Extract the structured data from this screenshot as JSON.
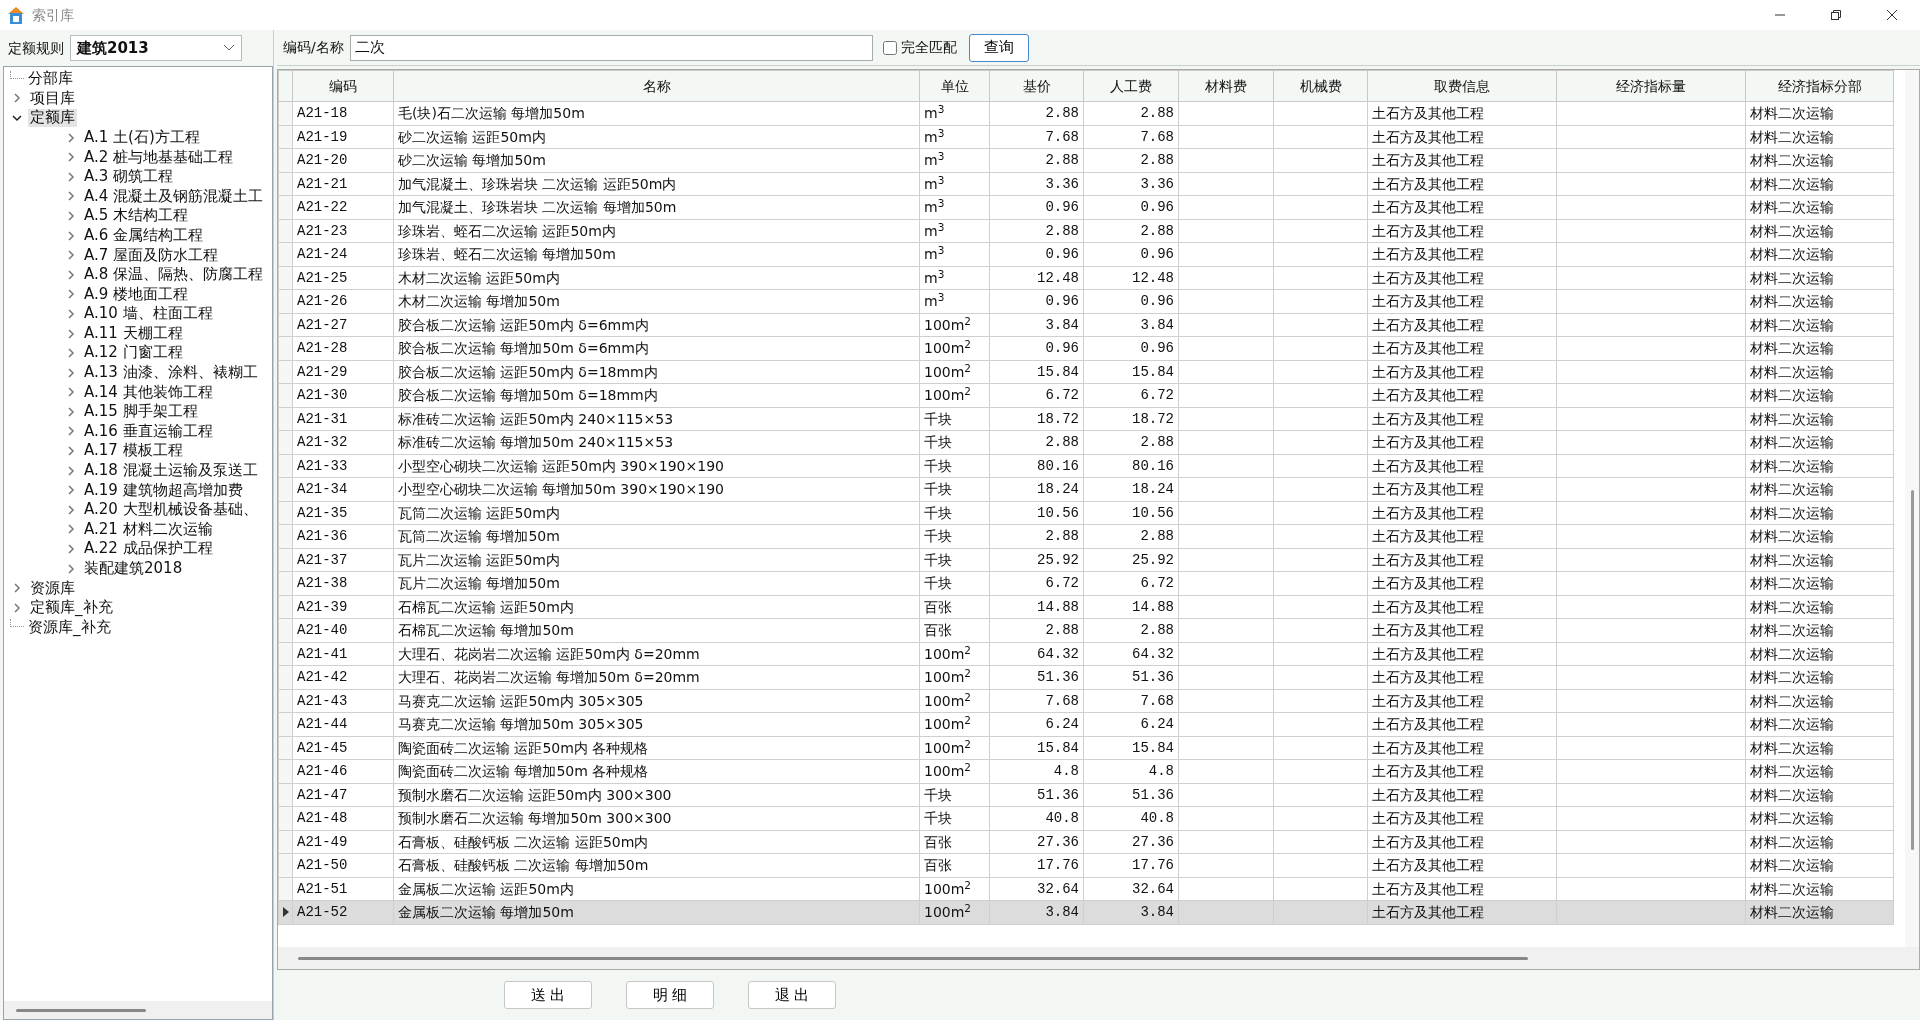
{
  "window": {
    "title": "索引库"
  },
  "rule": {
    "label": "定额规则",
    "value": "建筑2013"
  },
  "tree": [
    {
      "label": "分部库",
      "expanded": false,
      "selected": false,
      "has_children": false
    },
    {
      "label": "项目库",
      "expanded": false,
      "selected": false,
      "has_children": true
    },
    {
      "label": "定额库",
      "expanded": true,
      "selected": true,
      "has_children": true,
      "children": [
        {
          "label": "A.1 土(石)方工程",
          "expanded": false,
          "selected": false,
          "has_children": true
        },
        {
          "label": "A.2 桩与地基基础工程",
          "expanded": false,
          "selected": false,
          "has_children": true
        },
        {
          "label": "A.3 砌筑工程",
          "expanded": false,
          "selected": false,
          "has_children": true
        },
        {
          "label": "A.4 混凝土及钢筋混凝土工",
          "expanded": false,
          "selected": false,
          "has_children": true
        },
        {
          "label": "A.5 木结构工程",
          "expanded": false,
          "selected": false,
          "has_children": true
        },
        {
          "label": "A.6 金属结构工程",
          "expanded": false,
          "selected": false,
          "has_children": true
        },
        {
          "label": "A.7 屋面及防水工程",
          "expanded": false,
          "selected": false,
          "has_children": true
        },
        {
          "label": "A.8 保温、隔热、防腐工程",
          "expanded": false,
          "selected": false,
          "has_children": true
        },
        {
          "label": "A.9 楼地面工程",
          "expanded": false,
          "selected": false,
          "has_children": true
        },
        {
          "label": "A.10 墙、柱面工程",
          "expanded": false,
          "selected": false,
          "has_children": true
        },
        {
          "label": "A.11 天棚工程",
          "expanded": false,
          "selected": false,
          "has_children": true
        },
        {
          "label": "A.12 门窗工程",
          "expanded": false,
          "selected": false,
          "has_children": true
        },
        {
          "label": "A.13 油漆、涂料、裱糊工",
          "expanded": false,
          "selected": false,
          "has_children": true
        },
        {
          "label": "A.14 其他装饰工程",
          "expanded": false,
          "selected": false,
          "has_children": true
        },
        {
          "label": "A.15 脚手架工程",
          "expanded": false,
          "selected": false,
          "has_children": true
        },
        {
          "label": "A.16 垂直运输工程",
          "expanded": false,
          "selected": false,
          "has_children": true
        },
        {
          "label": "A.17 模板工程",
          "expanded": false,
          "selected": false,
          "has_children": true
        },
        {
          "label": "A.18 混凝土运输及泵送工",
          "expanded": false,
          "selected": false,
          "has_children": true
        },
        {
          "label": "A.19 建筑物超高增加费",
          "expanded": false,
          "selected": false,
          "has_children": true
        },
        {
          "label": "A.20 大型机械设备基础、",
          "expanded": false,
          "selected": false,
          "has_children": true
        },
        {
          "label": "A.21 材料二次运输",
          "expanded": false,
          "selected": false,
          "has_children": true
        },
        {
          "label": "A.22 成品保护工程",
          "expanded": false,
          "selected": false,
          "has_children": true
        },
        {
          "label": "装配建筑2018",
          "expanded": false,
          "selected": false,
          "has_children": true
        }
      ]
    },
    {
      "label": "资源库",
      "expanded": false,
      "selected": false,
      "has_children": true
    },
    {
      "label": "定额库_补充",
      "expanded": false,
      "selected": false,
      "has_children": true
    },
    {
      "label": "资源库_补充",
      "expanded": false,
      "selected": false,
      "has_children": false
    }
  ],
  "search": {
    "label": "编码/名称",
    "value": "二次",
    "exact_match": {
      "label": "完全匹配",
      "checked": false
    },
    "button": "查询"
  },
  "table": {
    "columns": [
      "编码",
      "名称",
      "单位",
      "基价",
      "人工费",
      "材料费",
      "机械费",
      "取费信息",
      "经济指标量",
      "经济指标分部"
    ],
    "rows": [
      {
        "code": "A21-18",
        "name": "毛(块)石二次运输 每增加50m",
        "unit": "m$^{3}$",
        "base_price": "2.88",
        "labor_cost": "2.88",
        "fee_info": "土石方及其他工程",
        "index_section": "材料二次运输",
        "selected": false
      },
      {
        "code": "A21-19",
        "name": "砂二次运输 运距50m内",
        "unit": "m$^{3}$",
        "base_price": "7.68",
        "labor_cost": "7.68",
        "fee_info": "土石方及其他工程",
        "index_section": "材料二次运输",
        "selected": false
      },
      {
        "code": "A21-20",
        "name": "砂二次运输 每增加50m",
        "unit": "m$^{3}$",
        "base_price": "2.88",
        "labor_cost": "2.88",
        "fee_info": "土石方及其他工程",
        "index_section": "材料二次运输",
        "selected": false
      },
      {
        "code": "A21-21",
        "name": "加气混凝土、珍珠岩块 二次运输 运距50m内",
        "unit": "m$^{3}$",
        "base_price": "3.36",
        "labor_cost": "3.36",
        "fee_info": "土石方及其他工程",
        "index_section": "材料二次运输",
        "selected": false
      },
      {
        "code": "A21-22",
        "name": "加气混凝土、珍珠岩块 二次运输 每增加50m",
        "unit": "m$^{3}$",
        "base_price": "0.96",
        "labor_cost": "0.96",
        "fee_info": "土石方及其他工程",
        "index_section": "材料二次运输",
        "selected": false
      },
      {
        "code": "A21-23",
        "name": "珍珠岩、蛭石二次运输 运距50m内",
        "unit": "m$^{3}$",
        "base_price": "2.88",
        "labor_cost": "2.88",
        "fee_info": "土石方及其他工程",
        "index_section": "材料二次运输",
        "selected": false
      },
      {
        "code": "A21-24",
        "name": "珍珠岩、蛭石二次运输 每增加50m",
        "unit": "m$^{3}$",
        "base_price": "0.96",
        "labor_cost": "0.96",
        "fee_info": "土石方及其他工程",
        "index_section": "材料二次运输",
        "selected": false
      },
      {
        "code": "A21-25",
        "name": "木材二次运输 运距50m内",
        "unit": "m$^{3}$",
        "base_price": "12.48",
        "labor_cost": "12.48",
        "fee_info": "土石方及其他工程",
        "index_section": "材料二次运输",
        "selected": false
      },
      {
        "code": "A21-26",
        "name": "木材二次运输 每增加50m",
        "unit": "m$^{3}$",
        "base_price": "0.96",
        "labor_cost": "0.96",
        "fee_info": "土石方及其他工程",
        "index_section": "材料二次运输",
        "selected": false
      },
      {
        "code": "A21-27",
        "name": "胶合板二次运输 运距50m内 δ=6mm内",
        "unit": "100m$^{2}$",
        "base_price": "3.84",
        "labor_cost": "3.84",
        "fee_info": "土石方及其他工程",
        "index_section": "材料二次运输",
        "selected": false
      },
      {
        "code": "A21-28",
        "name": "胶合板二次运输 每增加50m δ=6mm内",
        "unit": "100m$^{2}$",
        "base_price": "0.96",
        "labor_cost": "0.96",
        "fee_info": "土石方及其他工程",
        "index_section": "材料二次运输",
        "selected": false
      },
      {
        "code": "A21-29",
        "name": "胶合板二次运输 运距50m内 δ=18mm内",
        "unit": "100m$^{2}$",
        "base_price": "15.84",
        "labor_cost": "15.84",
        "fee_info": "土石方及其他工程",
        "index_section": "材料二次运输",
        "selected": false
      },
      {
        "code": "A21-30",
        "name": "胶合板二次运输 每增加50m δ=18mm内",
        "unit": "100m$^{2}$",
        "base_price": "6.72",
        "labor_cost": "6.72",
        "fee_info": "土石方及其他工程",
        "index_section": "材料二次运输",
        "selected": false
      },
      {
        "code": "A21-31",
        "name": "标准砖二次运输 运距50m内 240×115×53",
        "unit": "千块",
        "base_price": "18.72",
        "labor_cost": "18.72",
        "fee_info": "土石方及其他工程",
        "index_section": "材料二次运输",
        "selected": false
      },
      {
        "code": "A21-32",
        "name": "标准砖二次运输 每增加50m 240×115×53",
        "unit": "千块",
        "base_price": "2.88",
        "labor_cost": "2.88",
        "fee_info": "土石方及其他工程",
        "index_section": "材料二次运输",
        "selected": false
      },
      {
        "code": "A21-33",
        "name": "小型空心砌块二次运输 运距50m内 390×190×190",
        "unit": "千块",
        "base_price": "80.16",
        "labor_cost": "80.16",
        "fee_info": "土石方及其他工程",
        "index_section": "材料二次运输",
        "selected": false
      },
      {
        "code": "A21-34",
        "name": "小型空心砌块二次运输 每增加50m 390×190×190",
        "unit": "千块",
        "base_price": "18.24",
        "labor_cost": "18.24",
        "fee_info": "土石方及其他工程",
        "index_section": "材料二次运输",
        "selected": false
      },
      {
        "code": "A21-35",
        "name": "瓦筒二次运输 运距50m内",
        "unit": "千块",
        "base_price": "10.56",
        "labor_cost": "10.56",
        "fee_info": "土石方及其他工程",
        "index_section": "材料二次运输",
        "selected": false
      },
      {
        "code": "A21-36",
        "name": "瓦筒二次运输 每增加50m",
        "unit": "千块",
        "base_price": "2.88",
        "labor_cost": "2.88",
        "fee_info": "土石方及其他工程",
        "index_section": "材料二次运输",
        "selected": false
      },
      {
        "code": "A21-37",
        "name": "瓦片二次运输 运距50m内",
        "unit": "千块",
        "base_price": "25.92",
        "labor_cost": "25.92",
        "fee_info": "土石方及其他工程",
        "index_section": "材料二次运输",
        "selected": false
      },
      {
        "code": "A21-38",
        "name": "瓦片二次运输 每增加50m",
        "unit": "千块",
        "base_price": "6.72",
        "labor_cost": "6.72",
        "fee_info": "土石方及其他工程",
        "index_section": "材料二次运输",
        "selected": false
      },
      {
        "code": "A21-39",
        "name": "石棉瓦二次运输 运距50m内",
        "unit": "百张",
        "base_price": "14.88",
        "labor_cost": "14.88",
        "fee_info": "土石方及其他工程",
        "index_section": "材料二次运输",
        "selected": false
      },
      {
        "code": "A21-40",
        "name": "石棉瓦二次运输 每增加50m",
        "unit": "百张",
        "base_price": "2.88",
        "labor_cost": "2.88",
        "fee_info": "土石方及其他工程",
        "index_section": "材料二次运输",
        "selected": false
      },
      {
        "code": "A21-41",
        "name": "大理石、花岗岩二次运输 运距50m内 δ=20mm",
        "unit": "100m$^{2}$",
        "base_price": "64.32",
        "labor_cost": "64.32",
        "fee_info": "土石方及其他工程",
        "index_section": "材料二次运输",
        "selected": false
      },
      {
        "code": "A21-42",
        "name": "大理石、花岗岩二次运输 每增加50m δ=20mm",
        "unit": "100m$^{2}$",
        "base_price": "51.36",
        "labor_cost": "51.36",
        "fee_info": "土石方及其他工程",
        "index_section": "材料二次运输",
        "selected": false
      },
      {
        "code": "A21-43",
        "name": "马赛克二次运输 运距50m内 305×305",
        "unit": "100m$^{2}$",
        "base_price": "7.68",
        "labor_cost": "7.68",
        "fee_info": "土石方及其他工程",
        "index_section": "材料二次运输",
        "selected": false
      },
      {
        "code": "A21-44",
        "name": "马赛克二次运输 每增加50m 305×305",
        "unit": "100m$^{2}$",
        "base_price": "6.24",
        "labor_cost": "6.24",
        "fee_info": "土石方及其他工程",
        "index_section": "材料二次运输",
        "selected": false
      },
      {
        "code": "A21-45",
        "name": "陶瓷面砖二次运输 运距50m内 各种规格",
        "unit": "100m$^{2}$",
        "base_price": "15.84",
        "labor_cost": "15.84",
        "fee_info": "土石方及其他工程",
        "index_section": "材料二次运输",
        "selected": false
      },
      {
        "code": "A21-46",
        "name": "陶瓷面砖二次运输 每增加50m 各种规格",
        "unit": "100m$^{2}$",
        "base_price": "4.8",
        "labor_cost": "4.8",
        "fee_info": "土石方及其他工程",
        "index_section": "材料二次运输",
        "selected": false
      },
      {
        "code": "A21-47",
        "name": "预制水磨石二次运输 运距50m内 300×300",
        "unit": "千块",
        "base_price": "51.36",
        "labor_cost": "51.36",
        "fee_info": "土石方及其他工程",
        "index_section": "材料二次运输",
        "selected": false
      },
      {
        "code": "A21-48",
        "name": "预制水磨石二次运输 每增加50m 300×300",
        "unit": "千块",
        "base_price": "40.8",
        "labor_cost": "40.8",
        "fee_info": "土石方及其他工程",
        "index_section": "材料二次运输",
        "selected": false
      },
      {
        "code": "A21-49",
        "name": "石膏板、硅酸钙板 二次运输 运距50m内",
        "unit": "百张",
        "base_price": "27.36",
        "labor_cost": "27.36",
        "fee_info": "土石方及其他工程",
        "index_section": "材料二次运输",
        "selected": false
      },
      {
        "code": "A21-50",
        "name": "石膏板、硅酸钙板 二次运输 每增加50m",
        "unit": "百张",
        "base_price": "17.76",
        "labor_cost": "17.76",
        "fee_info": "土石方及其他工程",
        "index_section": "材料二次运输",
        "selected": false
      },
      {
        "code": "A21-51",
        "name": "金属板二次运输 运距50m内",
        "unit": "100m$^{2}$",
        "base_price": "32.64",
        "labor_cost": "32.64",
        "fee_info": "土石方及其他工程",
        "index_section": "材料二次运输",
        "selected": false
      },
      {
        "code": "A21-52",
        "name": "金属板二次运输 每增加50m",
        "unit": "100m$^{2}$",
        "base_price": "3.84",
        "labor_cost": "3.84",
        "fee_info": "土石方及其他工程",
        "index_section": "材料二次运输",
        "selected": true
      }
    ]
  },
  "buttons": [
    "送 出",
    "明 细",
    "退 出"
  ]
}
